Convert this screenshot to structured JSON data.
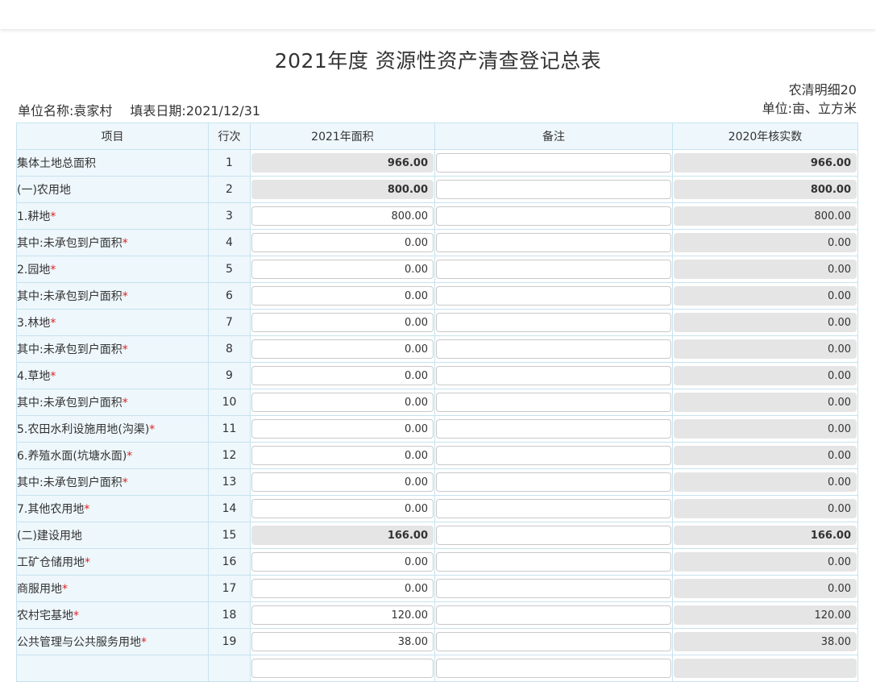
{
  "page": {
    "title": "2021年度 资源性资产清查登记总表",
    "unit_name_label": "单位名称:",
    "unit_name": "袁家村",
    "fill_date_label": "填表日期:",
    "fill_date": "2021/12/31",
    "form_code": "农清明细20",
    "unit_label": "单位:亩、立方米"
  },
  "table": {
    "headers": [
      "项目",
      "行次",
      "2021年面积",
      "备注",
      "2020年核实数"
    ],
    "rows": [
      {
        "name": "集体土地总面积",
        "req": false,
        "indent": 0,
        "idx": "1",
        "area": "966.00",
        "area_editable": false,
        "bold": true,
        "note": "",
        "prev": "966.00"
      },
      {
        "name": "(一)农用地",
        "req": false,
        "indent": 1,
        "idx": "2",
        "area": "800.00",
        "area_editable": false,
        "bold": true,
        "note": "",
        "prev": "800.00"
      },
      {
        "name": "1.耕地",
        "req": true,
        "indent": 2,
        "idx": "3",
        "area": "800.00",
        "area_editable": true,
        "bold": false,
        "note": "",
        "prev": "800.00"
      },
      {
        "name": "其中:未承包到户面积",
        "req": true,
        "indent": 3,
        "idx": "4",
        "area": "0.00",
        "area_editable": true,
        "bold": false,
        "note": "",
        "prev": "0.00"
      },
      {
        "name": "2.园地",
        "req": true,
        "indent": 2,
        "idx": "5",
        "area": "0.00",
        "area_editable": true,
        "bold": false,
        "note": "",
        "prev": "0.00"
      },
      {
        "name": "其中:未承包到户面积",
        "req": true,
        "indent": 3,
        "idx": "6",
        "area": "0.00",
        "area_editable": true,
        "bold": false,
        "note": "",
        "prev": "0.00"
      },
      {
        "name": "3.林地",
        "req": true,
        "indent": 2,
        "idx": "7",
        "area": "0.00",
        "area_editable": true,
        "bold": false,
        "note": "",
        "prev": "0.00"
      },
      {
        "name": "其中:未承包到户面积",
        "req": true,
        "indent": 3,
        "idx": "8",
        "area": "0.00",
        "area_editable": true,
        "bold": false,
        "note": "",
        "prev": "0.00"
      },
      {
        "name": "4.草地",
        "req": true,
        "indent": 2,
        "idx": "9",
        "area": "0.00",
        "area_editable": true,
        "bold": false,
        "note": "",
        "prev": "0.00"
      },
      {
        "name": "其中:未承包到户面积",
        "req": true,
        "indent": 3,
        "idx": "10",
        "area": "0.00",
        "area_editable": true,
        "bold": false,
        "note": "",
        "prev": "0.00"
      },
      {
        "name": "5.农田水利设施用地(沟渠)",
        "req": true,
        "indent": 2,
        "idx": "11",
        "area": "0.00",
        "area_editable": true,
        "bold": false,
        "note": "",
        "prev": "0.00"
      },
      {
        "name": "6.养殖水面(坑塘水面)",
        "req": true,
        "indent": 2,
        "idx": "12",
        "area": "0.00",
        "area_editable": true,
        "bold": false,
        "note": "",
        "prev": "0.00"
      },
      {
        "name": "其中:未承包到户面积",
        "req": true,
        "indent": 3,
        "idx": "13",
        "area": "0.00",
        "area_editable": true,
        "bold": false,
        "note": "",
        "prev": "0.00"
      },
      {
        "name": "7.其他农用地",
        "req": true,
        "indent": 2,
        "idx": "14",
        "area": "0.00",
        "area_editable": true,
        "bold": false,
        "note": "",
        "prev": "0.00"
      },
      {
        "name": "(二)建设用地",
        "req": false,
        "indent": 1,
        "idx": "15",
        "area": "166.00",
        "area_editable": false,
        "bold": true,
        "note": "",
        "prev": "166.00"
      },
      {
        "name": "工矿仓储用地",
        "req": true,
        "indent": 2,
        "idx": "16",
        "area": "0.00",
        "area_editable": true,
        "bold": false,
        "note": "",
        "prev": "0.00"
      },
      {
        "name": "商服用地",
        "req": true,
        "indent": 2,
        "idx": "17",
        "area": "0.00",
        "area_editable": true,
        "bold": false,
        "note": "",
        "prev": "0.00"
      },
      {
        "name": "农村宅基地",
        "req": true,
        "indent": 2,
        "idx": "18",
        "area": "120.00",
        "area_editable": true,
        "bold": false,
        "note": "",
        "prev": "120.00"
      },
      {
        "name": "公共管理与公共服务用地",
        "req": true,
        "indent": 2,
        "idx": "19",
        "area": "38.00",
        "area_editable": true,
        "bold": false,
        "note": "",
        "prev": "38.00"
      },
      {
        "name": "",
        "req": false,
        "indent": 2,
        "idx": "",
        "area": "",
        "area_editable": true,
        "bold": false,
        "note": "",
        "prev": ""
      }
    ]
  },
  "colors": {
    "header_bg": "#eef7fc",
    "border": "#c7e2ee",
    "readonly_bg": "#e5e5e5",
    "required_star": "#e02020"
  }
}
